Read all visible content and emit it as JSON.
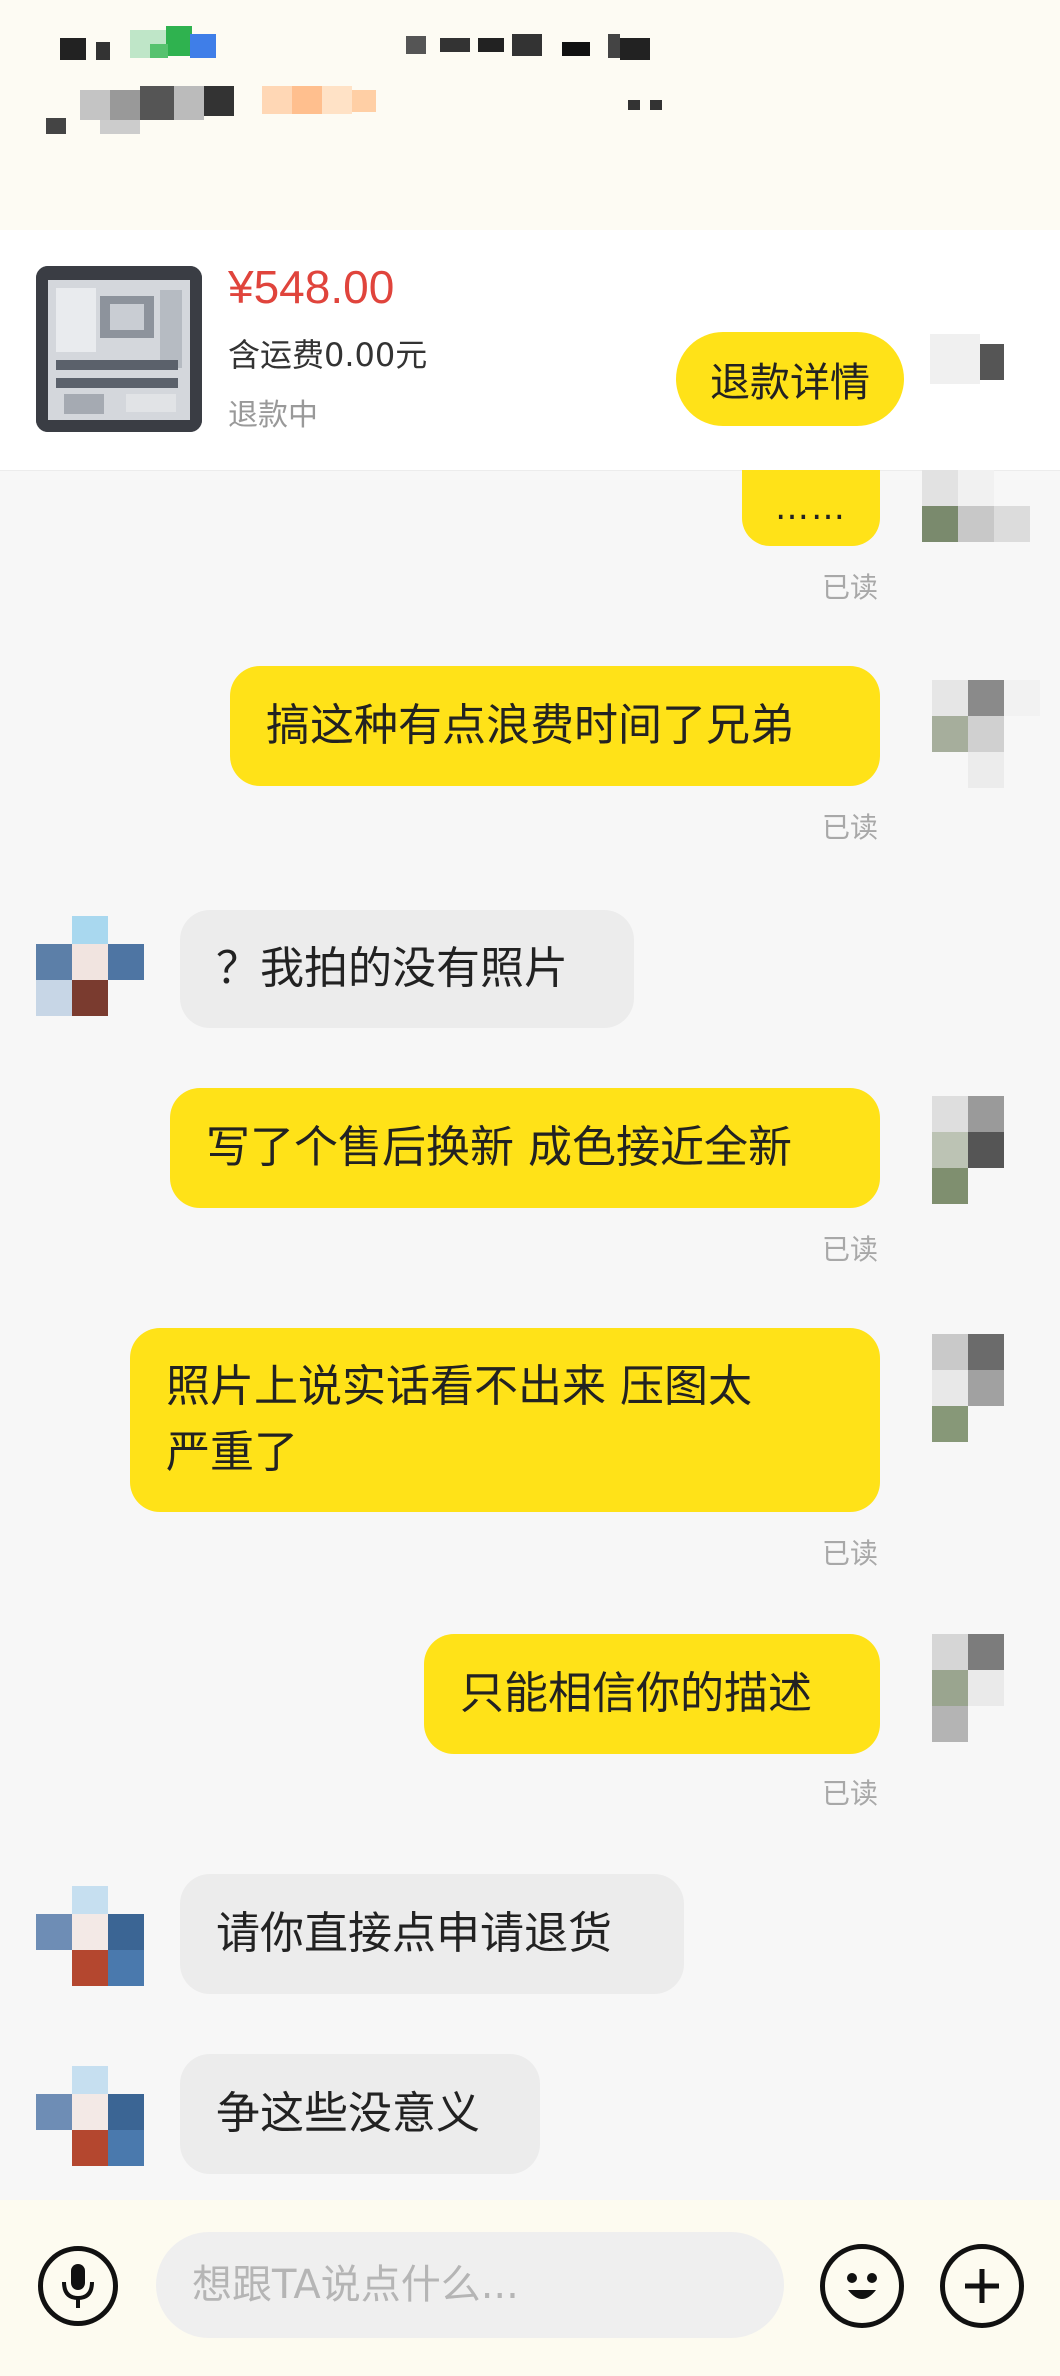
{
  "product": {
    "price": "¥548.00",
    "shipping": "含运费0.00元",
    "status": "退款中",
    "refund_button": "退款详情"
  },
  "messages": [
    {
      "from": "me",
      "text": "……",
      "read": "已读"
    },
    {
      "from": "me",
      "text": "搞这种有点浪费时间了兄弟",
      "read": "已读"
    },
    {
      "from": "them",
      "text": "？我拍的没有照片"
    },
    {
      "from": "me",
      "text": "写了个售后换新 成色接近全新",
      "read": "已读"
    },
    {
      "from": "me",
      "text": "照片上说实话看不出来 压图太\n严重了",
      "read": "已读"
    },
    {
      "from": "me",
      "text": "只能相信你的描述",
      "read": "已读"
    },
    {
      "from": "them",
      "text": "请你直接点申请退货"
    },
    {
      "from": "them",
      "text": "争这些没意义"
    }
  ],
  "input": {
    "placeholder": "想跟TA说点什么..."
  },
  "icons": {
    "voice": "microphone-icon",
    "emoji": "smiley-icon",
    "more": "plus-icon"
  },
  "colors": {
    "accent": "#ffe218",
    "price": "#e0443c"
  }
}
